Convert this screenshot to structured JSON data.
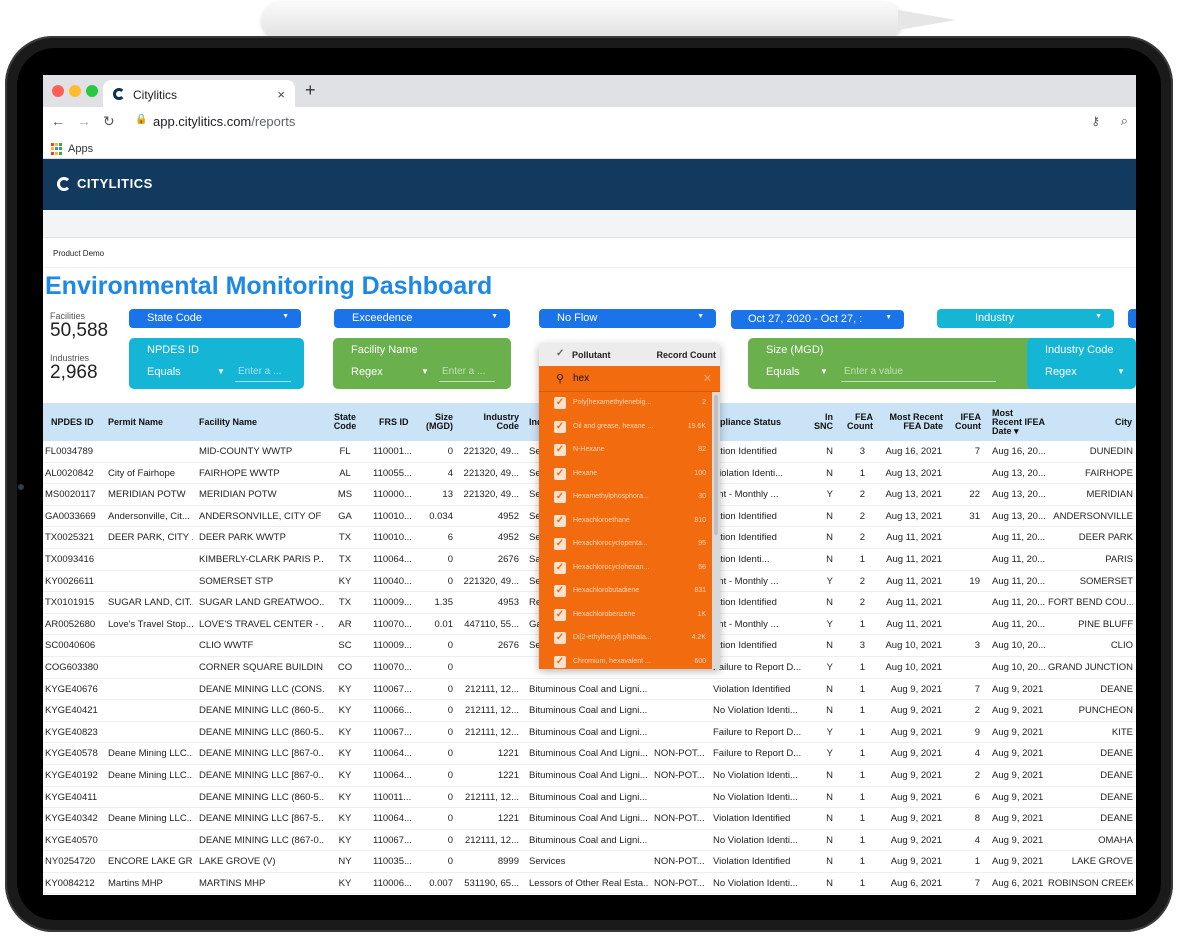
{
  "browser": {
    "tab_title": "Citylitics",
    "tab_close": "×",
    "new_tab": "+",
    "url_host": "app.citylitics.com",
    "url_path": "/reports",
    "bookmark_apps": "Apps"
  },
  "app": {
    "brand": "CITYLITICS",
    "breadcrumb": "Product Demo",
    "title": "Environmental Monitoring Dashboard"
  },
  "stats": {
    "facilities_label": "Facilities",
    "facilities_value": "50,588",
    "industries_label": "Industries",
    "industries_value": "2,968"
  },
  "filters": {
    "state_code": "State Code",
    "exceedence": "Exceedence",
    "no_flow": "No Flow",
    "date_range": "Oct 27, 2020 - Oct 27, :",
    "industry": "Industry",
    "npdes": {
      "label": "NPDES ID",
      "operator": "Equals",
      "placeholder": "Enter a ..."
    },
    "facility_name": {
      "label": "Facility Name",
      "operator": "Regex",
      "placeholder": "Enter a ..."
    },
    "size": {
      "label": "Size (MGD)",
      "operator": "Equals",
      "placeholder": "Enter a value"
    },
    "industry_code": {
      "label": "Industry Code",
      "operator": "Regex"
    }
  },
  "colors": {
    "blue": "#1a73e8",
    "cyan": "#15b5d6",
    "green": "#6ab04c",
    "orange": "#f26b0f",
    "header": "#12395e"
  },
  "table": {
    "headers": {
      "npdes": "NPDES ID",
      "permit": "Permit Name",
      "facility": "Facility Name",
      "state1": "State",
      "state2": "Code",
      "frs": "FRS ID",
      "size1": "Size",
      "size2": "(MGD)",
      "ind1": "Industry",
      "ind2": "Code",
      "inname": "Ind",
      "compliance": "pliance Status",
      "snc1": "In",
      "snc2": "SNC",
      "fea1": "FEA",
      "fea2": "Count",
      "mrfea1": "Most Recent",
      "mrfea2": "FEA Date",
      "ifea1": "IFEA",
      "ifea2": "Count",
      "mrifea1": "Most",
      "mrifea2": "Recent IFEA",
      "mrifea3": "Date ▾",
      "city": "City"
    },
    "rows": [
      [
        "FL0034789",
        "",
        "MID-COUNTY WWTP",
        "FL",
        "110001...",
        "0",
        "221320, 49...",
        "Se",
        "",
        "lation Identified",
        "N",
        "3",
        "Aug 16, 2021",
        "7",
        "Aug 16, 20...",
        "DUNEDIN"
      ],
      [
        "AL0020842",
        "City of Fairhope",
        "FAIRHOPE WWTP",
        "AL",
        "110055...",
        "4",
        "221320, 49...",
        "Se",
        "",
        "Violation Identi...",
        "N",
        "1",
        "Aug 13, 2021",
        "",
        "Aug 13, 20...",
        "FAIRHOPE"
      ],
      [
        "MS0020117",
        "MERIDIAN POTW",
        "MERIDIAN POTW",
        "MS",
        "110000...",
        "13",
        "221320, 49...",
        "Se",
        "",
        "ent - Monthly ...",
        "Y",
        "2",
        "Aug 13, 2021",
        "22",
        "Aug 13, 20...",
        "MERIDIAN"
      ],
      [
        "GA0033669",
        "Andersonville, Cit...",
        "ANDERSONVILLE, CITY OF ...",
        "GA",
        "110010...",
        "0.034",
        "4952",
        "Se",
        "",
        "lation Identified",
        "N",
        "2",
        "Aug 13, 2021",
        "31",
        "Aug 13, 20...",
        "ANDERSONVILLE"
      ],
      [
        "TX0025321",
        "DEER PARK, CITY ...",
        "DEER PARK WWTP",
        "TX",
        "110010...",
        "6",
        "4952",
        "Se",
        "",
        "lation Identified",
        "N",
        "2",
        "Aug 11, 2021",
        "",
        "Aug 11, 20...",
        "DEER PARK"
      ],
      [
        "TX0093416",
        "",
        "KIMBERLY-CLARK PARIS P...",
        "TX",
        "110064...",
        "0",
        "2676",
        "Sa",
        "",
        "lation Identi...",
        "N",
        "1",
        "Aug 11, 2021",
        "",
        "Aug 11, 20...",
        "PARIS"
      ],
      [
        "KY0026611",
        "",
        "SOMERSET STP",
        "KY",
        "110040...",
        "0",
        "221320, 49...",
        "Se",
        "",
        "ent - Monthly ...",
        "Y",
        "2",
        "Aug 11, 2021",
        "19",
        "Aug 11, 20...",
        "SOMERSET"
      ],
      [
        "TX0101915",
        "SUGAR LAND, CIT...",
        "SUGAR LAND GREATWOO...",
        "TX",
        "110009...",
        "1.35",
        "4953",
        "Re",
        "",
        "lation Identified",
        "N",
        "2",
        "Aug 11, 2021",
        "",
        "Aug 11, 20...",
        "FORT BEND COU..."
      ],
      [
        "AR0052680",
        "Love's Travel Stop...",
        "LOVE'S TRAVEL CENTER - ...",
        "AR",
        "110070...",
        "0.01",
        "447110, 55...",
        "Ga",
        "",
        "ent - Monthly ...",
        "Y",
        "1",
        "Aug 11, 2021",
        "",
        "Aug 11, 20...",
        "PINE BLUFF"
      ],
      [
        "SC0040606",
        "",
        "CLIO WWTF",
        "SC",
        "110009...",
        "0",
        "2676",
        "Se",
        "",
        "lation Identified",
        "N",
        "3",
        "Aug 10, 2021",
        "3",
        "Aug 10, 20...",
        "CLIO"
      ],
      [
        "COG603380",
        "",
        "CORNER SQUARE BUILDIN...",
        "CO",
        "110070...",
        "0",
        "",
        "",
        "",
        "Failure to Report D...",
        "Y",
        "1",
        "Aug 10, 2021",
        "",
        "Aug 10, 20...",
        "GRAND JUNCTION"
      ],
      [
        "KYGE40676",
        "",
        "DEANE MINING LLC (CONS...",
        "KY",
        "110067...",
        "0",
        "212111, 12...",
        "Bituminous Coal and Ligni...",
        "",
        "Violation Identified",
        "N",
        "1",
        "Aug 9, 2021",
        "7",
        "Aug 9, 2021",
        "DEANE"
      ],
      [
        "KYGE40421",
        "",
        "DEANE MINING LLC (860-5...",
        "KY",
        "110066...",
        "0",
        "212111, 12...",
        "Bituminous Coal and Ligni...",
        "",
        "No Violation Identi...",
        "N",
        "1",
        "Aug 9, 2021",
        "2",
        "Aug 9, 2021",
        "PUNCHEON"
      ],
      [
        "KYGE40823",
        "",
        "DEANE MINING LLC (860-5...",
        "KY",
        "110067...",
        "0",
        "212111, 12...",
        "Bituminous Coal and Ligni...",
        "",
        "Failure to Report D...",
        "Y",
        "1",
        "Aug 9, 2021",
        "9",
        "Aug 9, 2021",
        "KITE"
      ],
      [
        "KYGE40578",
        "Deane Mining LLC...",
        "DEANE MINING LLC [867-0...",
        "KY",
        "110064...",
        "0",
        "1221",
        "Bituminous Coal And Ligni...",
        "NON-POT...",
        "Failure to Report D...",
        "Y",
        "1",
        "Aug 9, 2021",
        "4",
        "Aug 9, 2021",
        "DEANE"
      ],
      [
        "KYGE40192",
        "Deane Mining LLC...",
        "DEANE MINING LLC [867-0...",
        "KY",
        "110064...",
        "0",
        "1221",
        "Bituminous Coal And Ligni...",
        "NON-POT...",
        "No Violation Identi...",
        "N",
        "1",
        "Aug 9, 2021",
        "2",
        "Aug 9, 2021",
        "DEANE"
      ],
      [
        "KYGE40411",
        "",
        "DEANE MINING LLC (860-5...",
        "KY",
        "110011...",
        "0",
        "212111, 12...",
        "Bituminous Coal and Ligni...",
        "",
        "No Violation Identi...",
        "N",
        "1",
        "Aug 9, 2021",
        "6",
        "Aug 9, 2021",
        "DEANE"
      ],
      [
        "KYGE40342",
        "Deane Mining LLC...",
        "DEANE MINING LLC [867-5...",
        "KY",
        "110064...",
        "0",
        "1221",
        "Bituminous Coal And Ligni...",
        "NON-POT...",
        "Violation Identified",
        "N",
        "1",
        "Aug 9, 2021",
        "8",
        "Aug 9, 2021",
        "DEANE"
      ],
      [
        "KYGE40570",
        "",
        "DEANE MINING LLC (867-0...",
        "KY",
        "110067...",
        "0",
        "212111, 12...",
        "Bituminous Coal and Ligni...",
        "",
        "No Violation Identi...",
        "N",
        "1",
        "Aug 9, 2021",
        "4",
        "Aug 9, 2021",
        "OMAHA"
      ],
      [
        "NY0254720",
        "ENCORE LAKE GR...",
        "LAKE GROVE (V)",
        "NY",
        "110035...",
        "0",
        "8999",
        "Services",
        "NON-POT...",
        "Violation Identified",
        "N",
        "1",
        "Aug 9, 2021",
        "1",
        "Aug 9, 2021",
        "LAKE GROVE"
      ],
      [
        "KY0084212",
        "Martins MHP",
        "MARTINS MHP",
        "KY",
        "110006...",
        "0.007",
        "531190, 65...",
        "Lessors of Other Real Esta...",
        "NON-POT...",
        "No Violation Identi...",
        "N",
        "1",
        "Aug 6, 2021",
        "7",
        "Aug 6, 2021",
        "ROBINSON CREEK"
      ]
    ]
  },
  "pollutant_dropdown": {
    "col_pollutant": "Pollutant",
    "col_count": "Record Count",
    "query": "hex",
    "items": [
      {
        "name": "Poly[hexamethylenebig...",
        "count": "2"
      },
      {
        "name": "Oil and grease, hexane ...",
        "count": "19.6K"
      },
      {
        "name": "N-Hexane",
        "count": "82"
      },
      {
        "name": "Hexane",
        "count": "100"
      },
      {
        "name": "Hexamethylphosphora...",
        "count": "30"
      },
      {
        "name": "Hexachloroethane",
        "count": "810"
      },
      {
        "name": "Hexachlorocyclopenta...",
        "count": "95"
      },
      {
        "name": "Hexachlorocyclohexan...",
        "count": "56"
      },
      {
        "name": "Hexachlorobutadiene",
        "count": "831"
      },
      {
        "name": "Hexachlorobenzene",
        "count": "1K"
      },
      {
        "name": "Di[2-ethylhexyl] phthala...",
        "count": "4.2K"
      },
      {
        "name": "Chromium, hexavalent ...",
        "count": "600"
      }
    ]
  }
}
